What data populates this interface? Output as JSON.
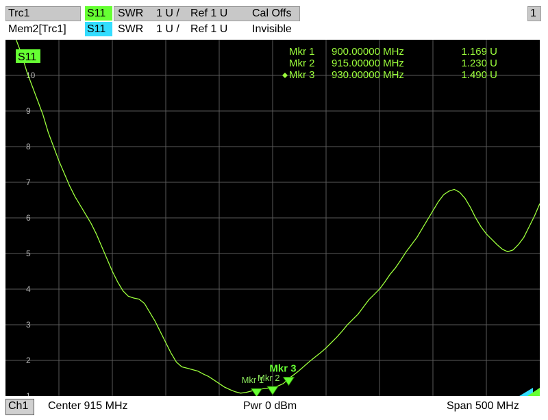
{
  "header": {
    "trace1_name": "Trc1",
    "trace1_param": "S11",
    "trace1_format": "SWR",
    "trace1_scale": "1 U /",
    "trace1_ref": "Ref 1 U",
    "trace1_status": "Cal Offs",
    "trace2_name": "Mem2[Trc1]",
    "trace2_param": "S11",
    "trace2_format": "SWR",
    "trace2_scale": "1 U /",
    "trace2_ref": "Ref 1 U",
    "trace2_status": "Invisible",
    "window_number": "1"
  },
  "footer": {
    "channel": "Ch1",
    "center": "Center  915 MHz",
    "power": "Pwr  0 dBm",
    "span": "Span  500 MHz"
  },
  "colors": {
    "trace": "#9cff3c",
    "marker": "#66ff33",
    "background": "#000000",
    "grid": "#5a5a5a",
    "ref_marker": "#33ddff"
  },
  "chart_data": {
    "type": "line",
    "trace_label": "S11",
    "ylim": [
      1,
      11
    ],
    "xlim": [
      665,
      1165
    ],
    "x_unit": "MHz",
    "y_ticks": [
      "1",
      "2",
      "3",
      "4",
      "5",
      "6",
      "7",
      "8",
      "9",
      "10"
    ],
    "grid": true,
    "series": [
      {
        "x": [
          675,
          680,
          685,
          690,
          695,
          700,
          705,
          710,
          715,
          720,
          725,
          730,
          735,
          740,
          745,
          750,
          755,
          760,
          765,
          770,
          775,
          780,
          785,
          790,
          795,
          800,
          805,
          810,
          815,
          820,
          825,
          830,
          835,
          840,
          845,
          850,
          855,
          860,
          865,
          870,
          875,
          880,
          885,
          890,
          895,
          900,
          905,
          910,
          915,
          920,
          925,
          930,
          935,
          940,
          945,
          950,
          955,
          960,
          965,
          970,
          975,
          980,
          985,
          990,
          995,
          1000,
          1005,
          1010,
          1015,
          1020,
          1025,
          1030,
          1035,
          1040,
          1045,
          1050,
          1055,
          1060,
          1065,
          1070,
          1075,
          1080,
          1085,
          1090,
          1095,
          1100,
          1105,
          1110,
          1115,
          1120,
          1125,
          1130,
          1135,
          1140,
          1145,
          1150,
          1155,
          1160,
          1165
        ],
        "y": [
          11.1,
          10.6,
          10.1,
          9.7,
          9.3,
          8.9,
          8.4,
          8.0,
          7.6,
          7.25,
          6.9,
          6.6,
          6.35,
          6.1,
          5.85,
          5.55,
          5.2,
          4.85,
          4.5,
          4.2,
          3.95,
          3.8,
          3.75,
          3.72,
          3.6,
          3.35,
          3.1,
          2.8,
          2.5,
          2.2,
          1.95,
          1.82,
          1.78,
          1.74,
          1.7,
          1.62,
          1.55,
          1.45,
          1.35,
          1.25,
          1.18,
          1.12,
          1.08,
          1.1,
          1.14,
          1.17,
          1.2,
          1.22,
          1.23,
          1.28,
          1.35,
          1.49,
          1.6,
          1.72,
          1.85,
          1.98,
          2.1,
          2.22,
          2.35,
          2.5,
          2.65,
          2.82,
          3.0,
          3.15,
          3.3,
          3.5,
          3.7,
          3.85,
          4.0,
          4.2,
          4.42,
          4.6,
          4.82,
          5.05,
          5.25,
          5.45,
          5.7,
          5.95,
          6.2,
          6.45,
          6.65,
          6.75,
          6.8,
          6.72,
          6.55,
          6.3,
          6.0,
          5.75,
          5.55,
          5.4,
          5.25,
          5.12,
          5.05,
          5.1,
          5.25,
          5.45,
          5.75,
          6.05,
          6.4
        ]
      }
    ],
    "markers": [
      {
        "label": "Mkr 1",
        "freq": "900.00000 MHz",
        "value": "1.169 U",
        "x": 900,
        "y": 1.169,
        "active": false
      },
      {
        "label": "Mkr 2",
        "freq": "915.00000 MHz",
        "value": "1.230 U",
        "x": 915,
        "y": 1.23,
        "active": false
      },
      {
        "label": "Mkr 3",
        "freq": "930.00000 MHz",
        "value": "1.490 U",
        "x": 930,
        "y": 1.49,
        "active": true
      }
    ],
    "active_marker_label": "Mkr 3",
    "marker_tag_labels": [
      "Mkr 1",
      "Mkr 2"
    ]
  }
}
